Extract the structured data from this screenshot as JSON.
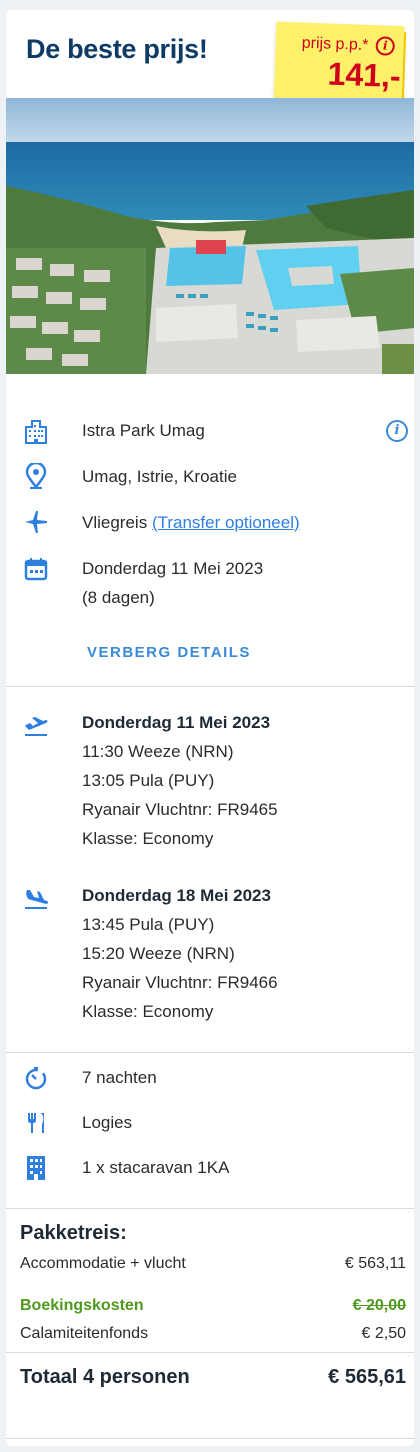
{
  "header": {
    "title": "De beste prijs!",
    "price_label": "prijs p.p.*",
    "price": "141,-"
  },
  "photo": {
    "description": ""
  },
  "summary": {
    "hotel": "Istra Park Umag",
    "location": "Umag, Istrie, Kroatie",
    "travel_type": "Vliegreis",
    "transfer_link": "(Transfer optioneel)",
    "date": "Donderdag 11 Mei 2023",
    "duration": "(8 dagen)",
    "toggle_label": "VERBERG DETAILS"
  },
  "flights": [
    {
      "date": "Donderdag 11 Mei 2023",
      "departure": "11:30 Weeze (NRN)",
      "arrival": "13:05 Pula (PUY)",
      "flight": "Ryanair Vluchtnr: FR9465",
      "class": "Klasse: Economy"
    },
    {
      "date": "Donderdag 18 Mei 2023",
      "departure": "13:45 Pula (PUY)",
      "arrival": "15:20 Weeze (NRN)",
      "flight": "Ryanair Vluchtnr: FR9466",
      "class": "Klasse: Economy"
    }
  ],
  "stay": {
    "nights": "7 nachten",
    "board": "Logies",
    "room": "1 x stacaravan 1KA"
  },
  "pricing": {
    "title": "Pakketreis:",
    "accommodation_label": "Accommodatie + vlucht",
    "accommodation_value": "€ 563,11",
    "booking_label": "Boekingskosten",
    "booking_value": "€ 20,00",
    "calamity_label": "Calamiteitenfonds",
    "calamity_value": "€ 2,50",
    "total_label": "Totaal 4 personen",
    "total_value": "€ 565,61"
  },
  "colors": {
    "accent": "#3a8ad8",
    "navy": "#0d3b66",
    "price_red": "#d0021b",
    "sticker": "#fff06a",
    "green": "#4f9a1e"
  }
}
